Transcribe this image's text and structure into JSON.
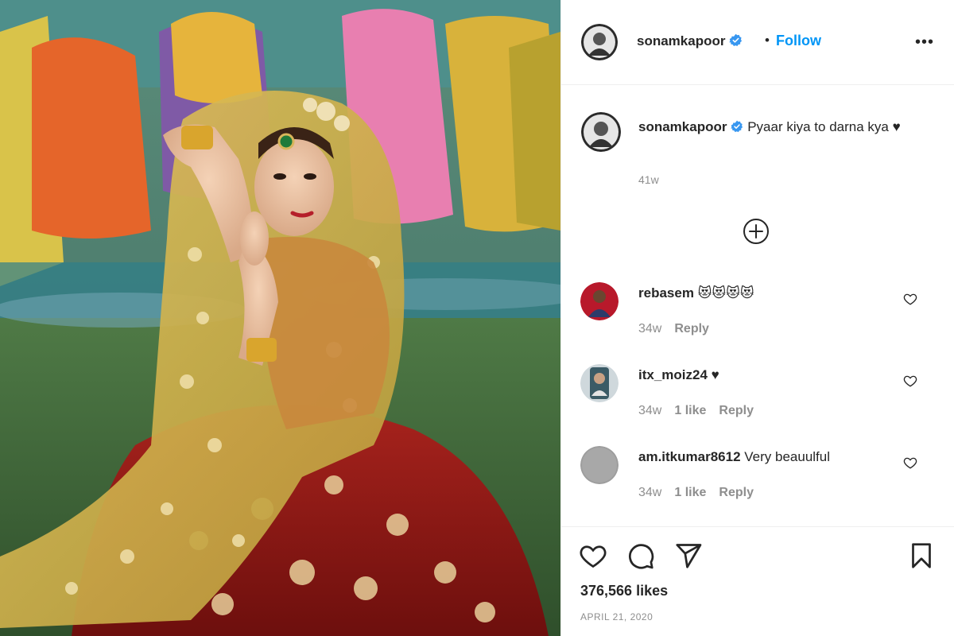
{
  "post": {
    "author": "sonamkapoor",
    "verified": true,
    "follow_label": "Follow",
    "more_label": "•••",
    "separator": "•",
    "photo_description": "Woman in bridal attire with gold embroidered veil and red lehenga against a painted backdrop"
  },
  "caption": {
    "username": "sonamkapoor",
    "text": "Pyaar kiya to darna kya ♥",
    "time": "41w"
  },
  "comments": [
    {
      "username": "rebasem",
      "text": "😻😻😻😻",
      "time": "34w",
      "likes": "",
      "reply_label": "Reply"
    },
    {
      "username": "itx_moiz24",
      "text": "♥",
      "time": "34w",
      "likes": "1 like",
      "reply_label": "Reply"
    },
    {
      "username": "am.itkumar8612",
      "text": "Very beauulful",
      "time": "34w",
      "likes": "1 like",
      "reply_label": "Reply"
    }
  ],
  "footer": {
    "likes": "376,566 likes",
    "date": "APRIL 21, 2020"
  },
  "icons": {
    "like": "heart-icon",
    "comment": "comment-bubble-icon",
    "share": "paper-plane-icon",
    "save": "bookmark-icon",
    "load_more": "plus-circle-icon",
    "verified": "verified-badge-icon"
  },
  "colors": {
    "follow": "#0095f6",
    "verified": "#3897f0",
    "muted": "#8e8e8e",
    "text": "#262626"
  }
}
